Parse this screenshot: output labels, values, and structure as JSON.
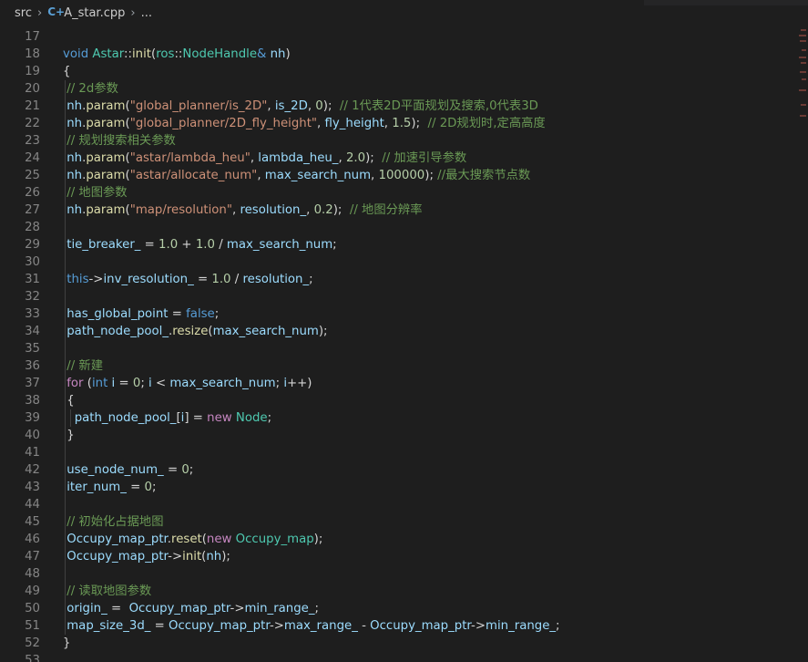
{
  "breadcrumb": {
    "folder": "src",
    "file": "A_star.cpp",
    "more": "..."
  },
  "colors": {
    "background": "#1e1e1e",
    "keyword": "#569cd6",
    "control": "#c586c0",
    "function": "#dcdcaa",
    "type": "#4ec9b0",
    "variable": "#9cdcfe",
    "string": "#ce9178",
    "number": "#b5cea8",
    "comment": "#6a9955"
  },
  "editor": {
    "lines": [
      {
        "n": "17",
        "tokens": []
      },
      {
        "n": "18",
        "tokens": [
          [
            "kw",
            "void"
          ],
          [
            "op",
            " "
          ],
          [
            "type",
            "Astar"
          ],
          [
            "op",
            "::"
          ],
          [
            "fn",
            "init"
          ],
          [
            "op",
            "("
          ],
          [
            "type",
            "ros"
          ],
          [
            "op",
            "::"
          ],
          [
            "type",
            "NodeHandle"
          ],
          [
            "kw",
            "&"
          ],
          [
            "op",
            " "
          ],
          [
            "var",
            "nh"
          ],
          [
            "op",
            ")"
          ]
        ]
      },
      {
        "n": "19",
        "tokens": [
          [
            "op",
            "{"
          ]
        ]
      },
      {
        "n": "20",
        "guide": 1,
        "tokens": [
          [
            "op",
            " "
          ],
          [
            "com",
            "// 2d参数"
          ]
        ]
      },
      {
        "n": "21",
        "guide": 1,
        "tokens": [
          [
            "op",
            " "
          ],
          [
            "var",
            "nh"
          ],
          [
            "op",
            "."
          ],
          [
            "fn",
            "param"
          ],
          [
            "op",
            "("
          ],
          [
            "str",
            "\"global_planner/is_2D\""
          ],
          [
            "op",
            ", "
          ],
          [
            "var",
            "is_2D"
          ],
          [
            "op",
            ", "
          ],
          [
            "num",
            "0"
          ],
          [
            "op",
            ");  "
          ],
          [
            "com",
            "// 1代表2D平面规划及搜索,0代表3D"
          ]
        ]
      },
      {
        "n": "22",
        "guide": 1,
        "tokens": [
          [
            "op",
            " "
          ],
          [
            "var",
            "nh"
          ],
          [
            "op",
            "."
          ],
          [
            "fn",
            "param"
          ],
          [
            "op",
            "("
          ],
          [
            "str",
            "\"global_planner/2D_fly_height\""
          ],
          [
            "op",
            ", "
          ],
          [
            "var",
            "fly_height"
          ],
          [
            "op",
            ", "
          ],
          [
            "num",
            "1.5"
          ],
          [
            "op",
            ");  "
          ],
          [
            "com",
            "// 2D规划时,定高高度"
          ]
        ]
      },
      {
        "n": "23",
        "guide": 1,
        "tokens": [
          [
            "op",
            " "
          ],
          [
            "com",
            "// 规划搜索相关参数"
          ]
        ]
      },
      {
        "n": "24",
        "guide": 1,
        "tokens": [
          [
            "op",
            " "
          ],
          [
            "var",
            "nh"
          ],
          [
            "op",
            "."
          ],
          [
            "fn",
            "param"
          ],
          [
            "op",
            "("
          ],
          [
            "str",
            "\"astar/lambda_heu\""
          ],
          [
            "op",
            ", "
          ],
          [
            "var",
            "lambda_heu_"
          ],
          [
            "op",
            ", "
          ],
          [
            "num",
            "2.0"
          ],
          [
            "op",
            ");  "
          ],
          [
            "com",
            "// 加速引导参数"
          ]
        ]
      },
      {
        "n": "25",
        "guide": 1,
        "tokens": [
          [
            "op",
            " "
          ],
          [
            "var",
            "nh"
          ],
          [
            "op",
            "."
          ],
          [
            "fn",
            "param"
          ],
          [
            "op",
            "("
          ],
          [
            "str",
            "\"astar/allocate_num\""
          ],
          [
            "op",
            ", "
          ],
          [
            "var",
            "max_search_num"
          ],
          [
            "op",
            ", "
          ],
          [
            "num",
            "100000"
          ],
          [
            "op",
            "); "
          ],
          [
            "com",
            "//最大搜索节点数"
          ]
        ]
      },
      {
        "n": "26",
        "guide": 1,
        "tokens": [
          [
            "op",
            " "
          ],
          [
            "com",
            "// 地图参数"
          ]
        ]
      },
      {
        "n": "27",
        "guide": 1,
        "tokens": [
          [
            "op",
            " "
          ],
          [
            "var",
            "nh"
          ],
          [
            "op",
            "."
          ],
          [
            "fn",
            "param"
          ],
          [
            "op",
            "("
          ],
          [
            "str",
            "\"map/resolution\""
          ],
          [
            "op",
            ", "
          ],
          [
            "var",
            "resolution_"
          ],
          [
            "op",
            ", "
          ],
          [
            "num",
            "0.2"
          ],
          [
            "op",
            ");  "
          ],
          [
            "com",
            "// 地图分辨率"
          ]
        ]
      },
      {
        "n": "28",
        "guide": 1,
        "tokens": []
      },
      {
        "n": "29",
        "guide": 1,
        "tokens": [
          [
            "op",
            " "
          ],
          [
            "var",
            "tie_breaker_"
          ],
          [
            "op",
            " = "
          ],
          [
            "num",
            "1.0"
          ],
          [
            "op",
            " + "
          ],
          [
            "num",
            "1.0"
          ],
          [
            "op",
            " / "
          ],
          [
            "var",
            "max_search_num"
          ],
          [
            "op",
            ";"
          ]
        ]
      },
      {
        "n": "30",
        "guide": 1,
        "tokens": []
      },
      {
        "n": "31",
        "guide": 1,
        "tokens": [
          [
            "op",
            " "
          ],
          [
            "kw",
            "this"
          ],
          [
            "op",
            "->"
          ],
          [
            "var",
            "inv_resolution_"
          ],
          [
            "op",
            " = "
          ],
          [
            "num",
            "1.0"
          ],
          [
            "op",
            " / "
          ],
          [
            "var",
            "resolution_"
          ],
          [
            "op",
            ";"
          ]
        ]
      },
      {
        "n": "32",
        "guide": 1,
        "tokens": []
      },
      {
        "n": "33",
        "guide": 1,
        "tokens": [
          [
            "op",
            " "
          ],
          [
            "var",
            "has_global_point"
          ],
          [
            "op",
            " = "
          ],
          [
            "kw",
            "false"
          ],
          [
            "op",
            ";"
          ]
        ]
      },
      {
        "n": "34",
        "guide": 1,
        "tokens": [
          [
            "op",
            " "
          ],
          [
            "var",
            "path_node_pool_"
          ],
          [
            "op",
            "."
          ],
          [
            "fn",
            "resize"
          ],
          [
            "op",
            "("
          ],
          [
            "var",
            "max_search_num"
          ],
          [
            "op",
            ");"
          ]
        ]
      },
      {
        "n": "35",
        "guide": 1,
        "tokens": []
      },
      {
        "n": "36",
        "guide": 1,
        "tokens": [
          [
            "op",
            " "
          ],
          [
            "com",
            "// 新建"
          ]
        ]
      },
      {
        "n": "37",
        "guide": 1,
        "tokens": [
          [
            "op",
            " "
          ],
          [
            "kw2",
            "for"
          ],
          [
            "op",
            " ("
          ],
          [
            "kw",
            "int"
          ],
          [
            "op",
            " "
          ],
          [
            "var",
            "i"
          ],
          [
            "op",
            " = "
          ],
          [
            "num",
            "0"
          ],
          [
            "op",
            "; "
          ],
          [
            "var",
            "i"
          ],
          [
            "op",
            " < "
          ],
          [
            "var",
            "max_search_num"
          ],
          [
            "op",
            "; "
          ],
          [
            "var",
            "i"
          ],
          [
            "op",
            "++)"
          ]
        ]
      },
      {
        "n": "38",
        "guide": 1,
        "tokens": [
          [
            "op",
            " {"
          ]
        ]
      },
      {
        "n": "39",
        "guide": 2,
        "tokens": [
          [
            "op",
            "   "
          ],
          [
            "var",
            "path_node_pool_"
          ],
          [
            "op",
            "["
          ],
          [
            "var",
            "i"
          ],
          [
            "op",
            "] = "
          ],
          [
            "kw2",
            "new"
          ],
          [
            "op",
            " "
          ],
          [
            "type",
            "Node"
          ],
          [
            "op",
            ";"
          ]
        ]
      },
      {
        "n": "40",
        "guide": 1,
        "tokens": [
          [
            "op",
            " }"
          ]
        ]
      },
      {
        "n": "41",
        "guide": 1,
        "tokens": []
      },
      {
        "n": "42",
        "guide": 1,
        "tokens": [
          [
            "op",
            " "
          ],
          [
            "var",
            "use_node_num_"
          ],
          [
            "op",
            " = "
          ],
          [
            "num",
            "0"
          ],
          [
            "op",
            ";"
          ]
        ]
      },
      {
        "n": "43",
        "guide": 1,
        "tokens": [
          [
            "op",
            " "
          ],
          [
            "var",
            "iter_num_"
          ],
          [
            "op",
            " = "
          ],
          [
            "num",
            "0"
          ],
          [
            "op",
            ";"
          ]
        ]
      },
      {
        "n": "44",
        "guide": 1,
        "tokens": []
      },
      {
        "n": "45",
        "guide": 1,
        "tokens": [
          [
            "op",
            " "
          ],
          [
            "com",
            "// 初始化占据地图"
          ]
        ]
      },
      {
        "n": "46",
        "guide": 1,
        "tokens": [
          [
            "op",
            " "
          ],
          [
            "var",
            "Occupy_map_ptr"
          ],
          [
            "op",
            "."
          ],
          [
            "fn",
            "reset"
          ],
          [
            "op",
            "("
          ],
          [
            "kw2",
            "new"
          ],
          [
            "op",
            " "
          ],
          [
            "type",
            "Occupy_map"
          ],
          [
            "op",
            ");"
          ]
        ]
      },
      {
        "n": "47",
        "guide": 1,
        "tokens": [
          [
            "op",
            " "
          ],
          [
            "var",
            "Occupy_map_ptr"
          ],
          [
            "op",
            "->"
          ],
          [
            "fn",
            "init"
          ],
          [
            "op",
            "("
          ],
          [
            "var",
            "nh"
          ],
          [
            "op",
            ");"
          ]
        ]
      },
      {
        "n": "48",
        "guide": 1,
        "tokens": []
      },
      {
        "n": "49",
        "guide": 1,
        "tokens": [
          [
            "op",
            " "
          ],
          [
            "com",
            "// 读取地图参数"
          ]
        ]
      },
      {
        "n": "50",
        "guide": 1,
        "tokens": [
          [
            "op",
            " "
          ],
          [
            "var",
            "origin_"
          ],
          [
            "op",
            " =  "
          ],
          [
            "var",
            "Occupy_map_ptr"
          ],
          [
            "op",
            "->"
          ],
          [
            "var",
            "min_range_"
          ],
          [
            "op",
            ";"
          ]
        ]
      },
      {
        "n": "51",
        "guide": 1,
        "tokens": [
          [
            "op",
            " "
          ],
          [
            "var",
            "map_size_3d_"
          ],
          [
            "op",
            " = "
          ],
          [
            "var",
            "Occupy_map_ptr"
          ],
          [
            "op",
            "->"
          ],
          [
            "var",
            "max_range_"
          ],
          [
            "op",
            " - "
          ],
          [
            "var",
            "Occupy_map_ptr"
          ],
          [
            "op",
            "->"
          ],
          [
            "var",
            "min_range_"
          ],
          [
            "op",
            ";"
          ]
        ]
      },
      {
        "n": "52",
        "tokens": [
          [
            "op",
            "}"
          ]
        ]
      },
      {
        "n": "53",
        "tokens": []
      }
    ]
  }
}
